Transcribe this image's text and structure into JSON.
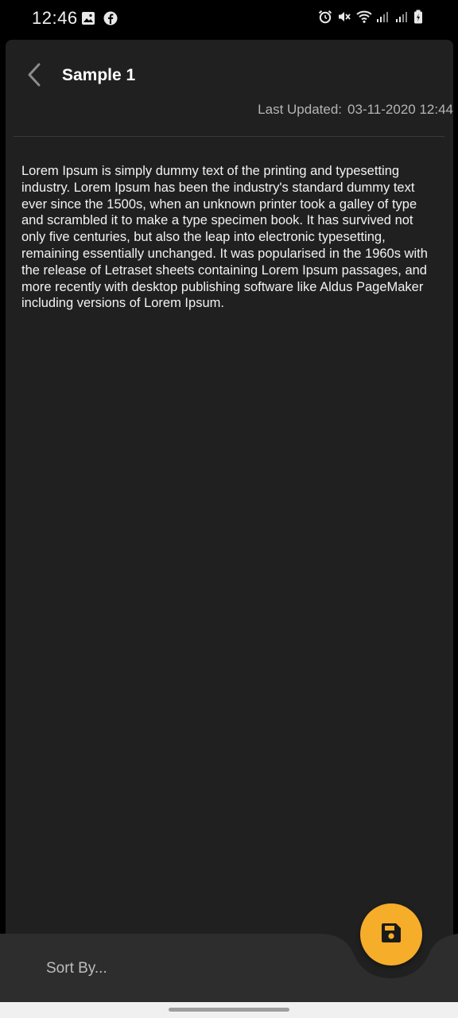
{
  "status_bar": {
    "time": "12:46",
    "left_icons": [
      "image-icon",
      "facebook-icon"
    ],
    "right_icons": [
      "alarm-icon",
      "mute-icon",
      "wifi-icon",
      "signal-icon",
      "signal-icon",
      "battery-icon"
    ]
  },
  "header": {
    "back_icon": "chevron-left-icon",
    "title": "Sample 1",
    "last_updated_label": "Last Updated:",
    "last_updated_value": "03-11-2020 12:44"
  },
  "note": {
    "body": "Lorem Ipsum is simply dummy text of the printing and typesetting industry. Lorem Ipsum has been the industry's standard dummy text ever since the 1500s, when an unknown printer took a galley of type and scrambled it to make a type specimen book. It has survived not only five centuries, but also the leap into electronic typesetting, remaining essentially unchanged. It was popularised in the 1960s with the release of Letraset sheets containing Lorem Ipsum passages, and more recently with desktop publishing software like Aldus PageMaker including versions of Lorem Ipsum."
  },
  "bottom_bar": {
    "sort_label": "Sort By...",
    "fab_icon": "save-icon"
  },
  "colors": {
    "background": "#000000",
    "card": "#202020",
    "bottom_bar": "#2d2d2d",
    "accent": "#f6ad2a",
    "text_primary": "#ffffff",
    "text_secondary": "#b4b4b4"
  }
}
